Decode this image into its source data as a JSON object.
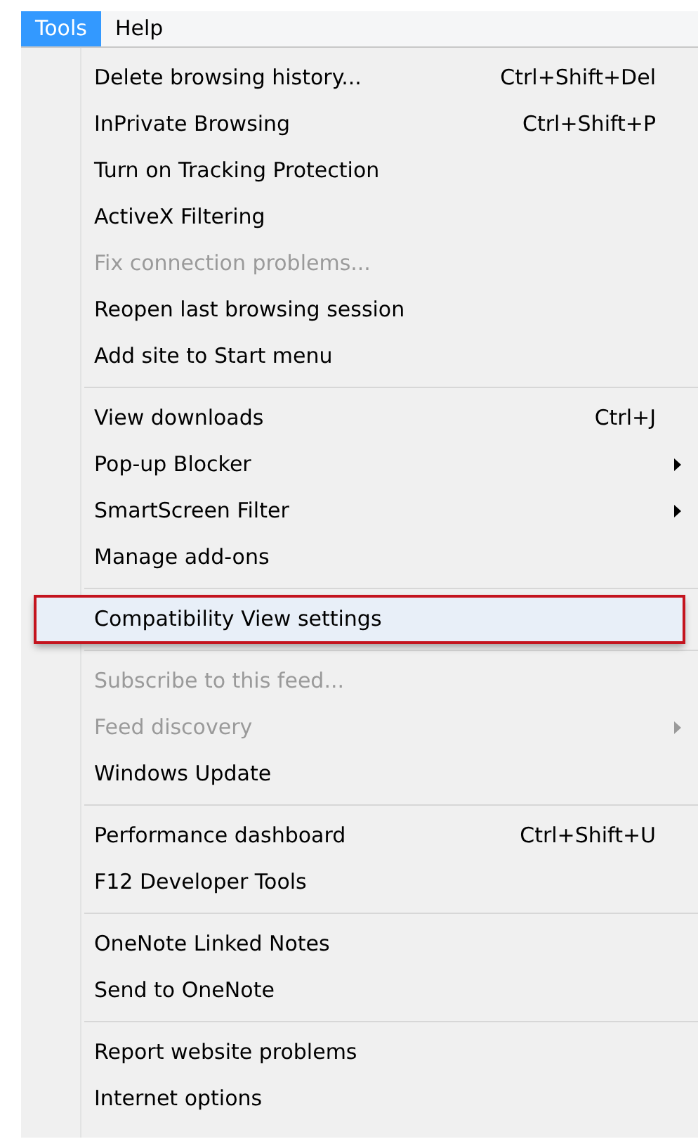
{
  "menu_bar": [
    {
      "label": "Tools",
      "selected": true
    },
    {
      "label": "Help",
      "selected": false
    }
  ],
  "menu": [
    {
      "kind": "item",
      "label": "Delete browsing history...",
      "shortcut": "Ctrl+Shift+Del",
      "disabled": false,
      "submenu": false,
      "selected": false
    },
    {
      "kind": "item",
      "label": "InPrivate Browsing",
      "shortcut": "Ctrl+Shift+P",
      "disabled": false,
      "submenu": false,
      "selected": false
    },
    {
      "kind": "item",
      "label": "Turn on Tracking Protection",
      "disabled": false,
      "submenu": false,
      "selected": false
    },
    {
      "kind": "item",
      "label": "ActiveX Filtering",
      "disabled": false,
      "submenu": false,
      "selected": false
    },
    {
      "kind": "item",
      "label": "Fix connection problems...",
      "disabled": true,
      "submenu": false,
      "selected": false
    },
    {
      "kind": "item",
      "label": "Reopen last browsing session",
      "disabled": false,
      "submenu": false,
      "selected": false
    },
    {
      "kind": "item",
      "label": "Add site to Start menu",
      "disabled": false,
      "submenu": false,
      "selected": false
    },
    {
      "kind": "separator"
    },
    {
      "kind": "item",
      "label": "View downloads",
      "shortcut": "Ctrl+J",
      "disabled": false,
      "submenu": false,
      "selected": false
    },
    {
      "kind": "item",
      "label": "Pop-up Blocker",
      "disabled": false,
      "submenu": true,
      "selected": false
    },
    {
      "kind": "item",
      "label": "SmartScreen Filter",
      "disabled": false,
      "submenu": true,
      "selected": false
    },
    {
      "kind": "item",
      "label": "Manage add-ons",
      "disabled": false,
      "submenu": false,
      "selected": false
    },
    {
      "kind": "separator"
    },
    {
      "kind": "item",
      "label": "Compatibility View settings",
      "disabled": false,
      "submenu": false,
      "selected": true
    },
    {
      "kind": "separator"
    },
    {
      "kind": "item",
      "label": "Subscribe to this feed...",
      "disabled": true,
      "submenu": false,
      "selected": false
    },
    {
      "kind": "item",
      "label": "Feed discovery",
      "disabled": true,
      "submenu": true,
      "selected": false
    },
    {
      "kind": "item",
      "label": "Windows Update",
      "disabled": false,
      "submenu": false,
      "selected": false
    },
    {
      "kind": "separator"
    },
    {
      "kind": "item",
      "label": "Performance dashboard",
      "shortcut": "Ctrl+Shift+U",
      "disabled": false,
      "submenu": false,
      "selected": false
    },
    {
      "kind": "item",
      "label": "F12 Developer Tools",
      "disabled": false,
      "submenu": false,
      "selected": false
    },
    {
      "kind": "separator"
    },
    {
      "kind": "item",
      "label": "OneNote Linked Notes",
      "disabled": false,
      "submenu": false,
      "selected": false
    },
    {
      "kind": "item",
      "label": "Send to OneNote",
      "disabled": false,
      "submenu": false,
      "selected": false
    },
    {
      "kind": "separator"
    },
    {
      "kind": "item",
      "label": "Report website problems",
      "disabled": false,
      "submenu": false,
      "selected": false
    },
    {
      "kind": "item",
      "label": "Internet options",
      "disabled": false,
      "submenu": false,
      "selected": false
    }
  ]
}
